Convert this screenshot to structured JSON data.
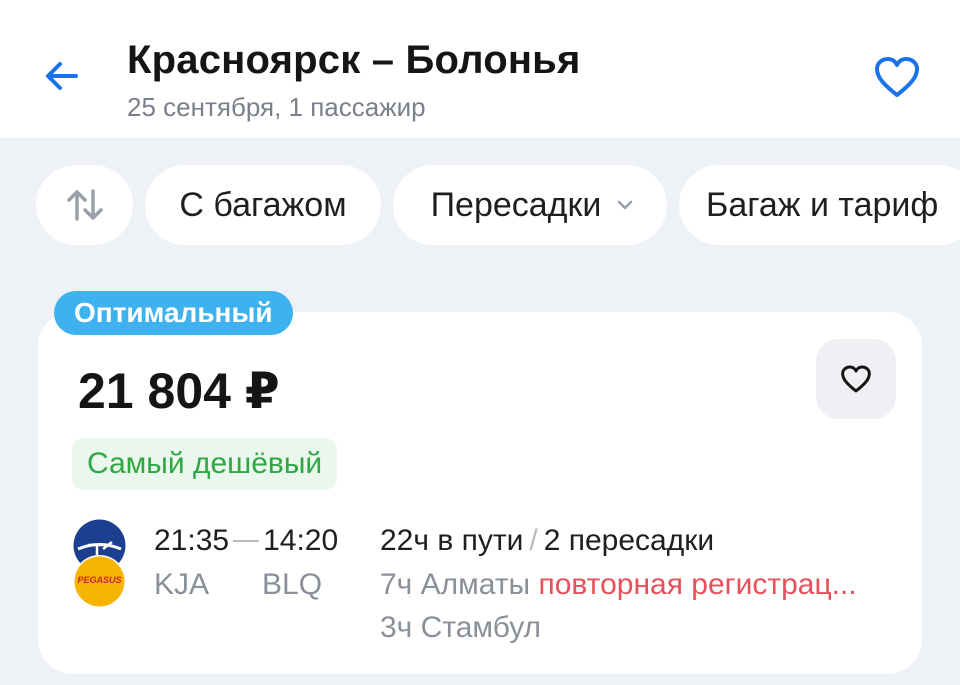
{
  "header": {
    "title": "Красноярск – Болонья",
    "subtitle": "25 сентября, 1 пассажир"
  },
  "filters": [
    {
      "label": "С багажом"
    },
    {
      "label": "Пересадки"
    },
    {
      "label": "Багаж и тариф"
    }
  ],
  "offer": {
    "badge": "Оптимальный",
    "price": "21 804 ₽",
    "tag": "Самый дешёвый",
    "departure_time": "21:35",
    "arrival_time": "14:20",
    "from_code": "KJA",
    "to_code": "BLQ",
    "duration": "22ч в пути",
    "transfers": "2 пересадки",
    "stops": [
      {
        "duration_city": "7ч Алматы",
        "warning": "повторная регистрац..."
      },
      {
        "duration_city": "3ч Стамбул"
      }
    ],
    "airline_logo_text": "PEGASUS"
  },
  "colors": {
    "accent": "#1a73e8",
    "badge_bg": "#3db2ee",
    "cheapest_text": "#2fa744",
    "warning": "#e8505b"
  },
  "icons": [
    "back-arrow-icon",
    "heart-icon",
    "sort-icon",
    "chevron-down-icon"
  ]
}
